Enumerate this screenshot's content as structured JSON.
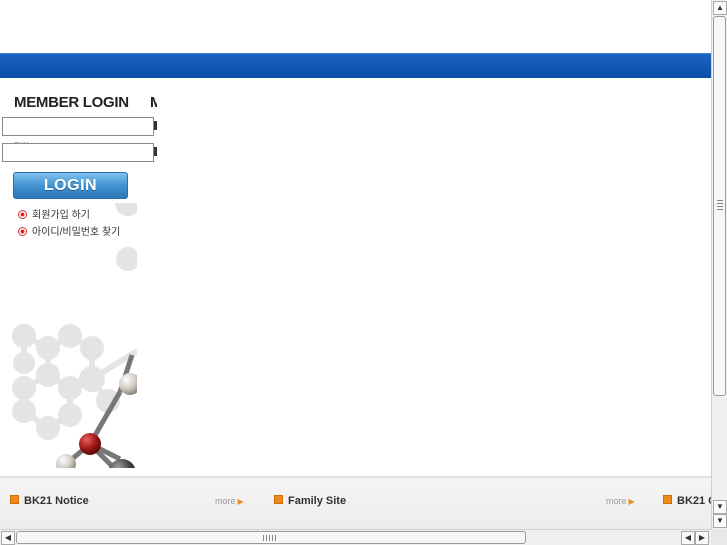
{
  "login": {
    "title": "MEMBER LOGIN",
    "title_cut": "M",
    "id_field": {
      "value": "",
      "placeholder": ""
    },
    "pw_field": {
      "value": "",
      "placeholder": ""
    },
    "pw_ghost": "PW",
    "login_button": "LOGIN",
    "links": [
      "회원가입 하기",
      "아이디/비밀번호 찾기"
    ]
  },
  "footer": {
    "boxes": [
      {
        "title": "BK21 Notice",
        "more": "more"
      },
      {
        "title": "Family Site",
        "more": "more"
      },
      {
        "title": "BK21 C"
      }
    ]
  },
  "colors": {
    "band_blue": "#0d4ea6",
    "login_button_blue": "#3f8fcd",
    "footer_accent_orange": "#f08a1c",
    "link_bullet_red": "#cc2222"
  },
  "icons": [
    "radio-bullet-icon",
    "orange-square-icon",
    "more-arrow-icon",
    "scroll-up-icon",
    "scroll-down-icon",
    "scroll-left-icon",
    "scroll-right-icon"
  ]
}
